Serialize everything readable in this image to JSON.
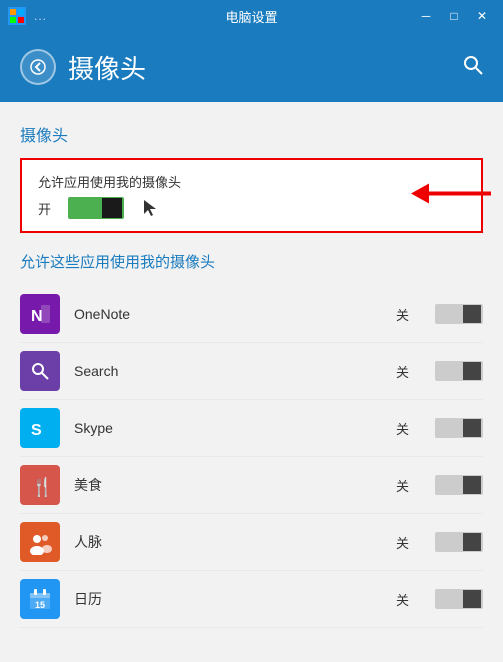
{
  "titleBar": {
    "icon": "⊞",
    "dots": "...",
    "title": "电脑设置",
    "minimize": "─",
    "maximize": "□",
    "close": "✕"
  },
  "header": {
    "backLabel": "❮",
    "pageTitle": "摄像头",
    "searchIcon": "🔍"
  },
  "content": {
    "sectionTitle": "摄像头",
    "toggleLabel": "允许应用使用我的摄像头",
    "toggleState": "开",
    "subSectionTitle": "允许这些应用使用我的摄像头",
    "apps": [
      {
        "name": "OneNote",
        "state": "关",
        "iconType": "onenote",
        "iconChar": "N"
      },
      {
        "name": "Search",
        "state": "关",
        "iconType": "search",
        "iconChar": "🔍"
      },
      {
        "name": "Skype",
        "state": "关",
        "iconType": "skype",
        "iconChar": "S"
      },
      {
        "name": "美食",
        "state": "关",
        "iconType": "food",
        "iconChar": "🍴"
      },
      {
        "name": "人脉",
        "state": "关",
        "iconType": "people",
        "iconChar": "👥"
      },
      {
        "name": "日历",
        "state": "关",
        "iconType": "calendar",
        "iconChar": "📅"
      }
    ]
  }
}
